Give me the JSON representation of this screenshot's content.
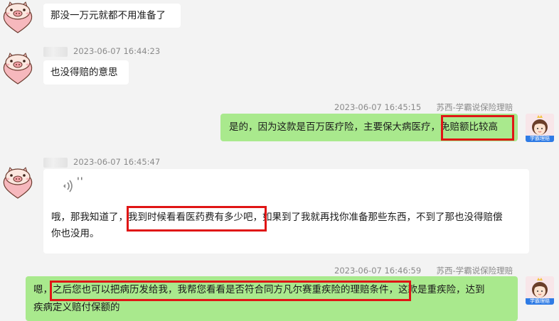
{
  "messages": [
    {
      "text": "那没一万元就都不用准备了"
    },
    {
      "time": "2023-06-07 16:44:23",
      "text": "也没得赔的意思"
    },
    {
      "time": "2023-06-07 16:45:15",
      "sender": "苏西-学霸说保险理赔",
      "text_before": "是的，因为这款是百万医疗险，主要保大病医疗，",
      "text_highlight": "免赔额比较高"
    },
    {
      "time": "2023-06-07 16:45:47",
      "voice_icon": "sound-wave-icon",
      "voice_mark": "''",
      "line1_before": "哦，那我知道了，",
      "line1_highlight": "我到时候看看医药费有多少吧，",
      "line1_after": "如果到了我就再找你准备那些东西，不到了那也没得赔偿",
      "line2": "你也没用。"
    },
    {
      "time": "2023-06-07 16:46:59",
      "sender": "苏西-学霸说保险理赔",
      "line1_before": "嗯，",
      "line1_highlight": "之后您也可以把病历发给我，我帮您看看是否符合同方凡尔赛重疾险的理赔条件，",
      "line1_after": "这款是重疾险，达到",
      "line2": "疾病定义赔付保额的"
    }
  ],
  "agent_avatar_label": "学霸理赔",
  "colors": {
    "background": "#f3f3f3",
    "incoming_bubble": "#ffffff",
    "outgoing_bubble": "#a9e98d",
    "highlight": "#e01515",
    "meta_text": "#8a8a8a"
  }
}
